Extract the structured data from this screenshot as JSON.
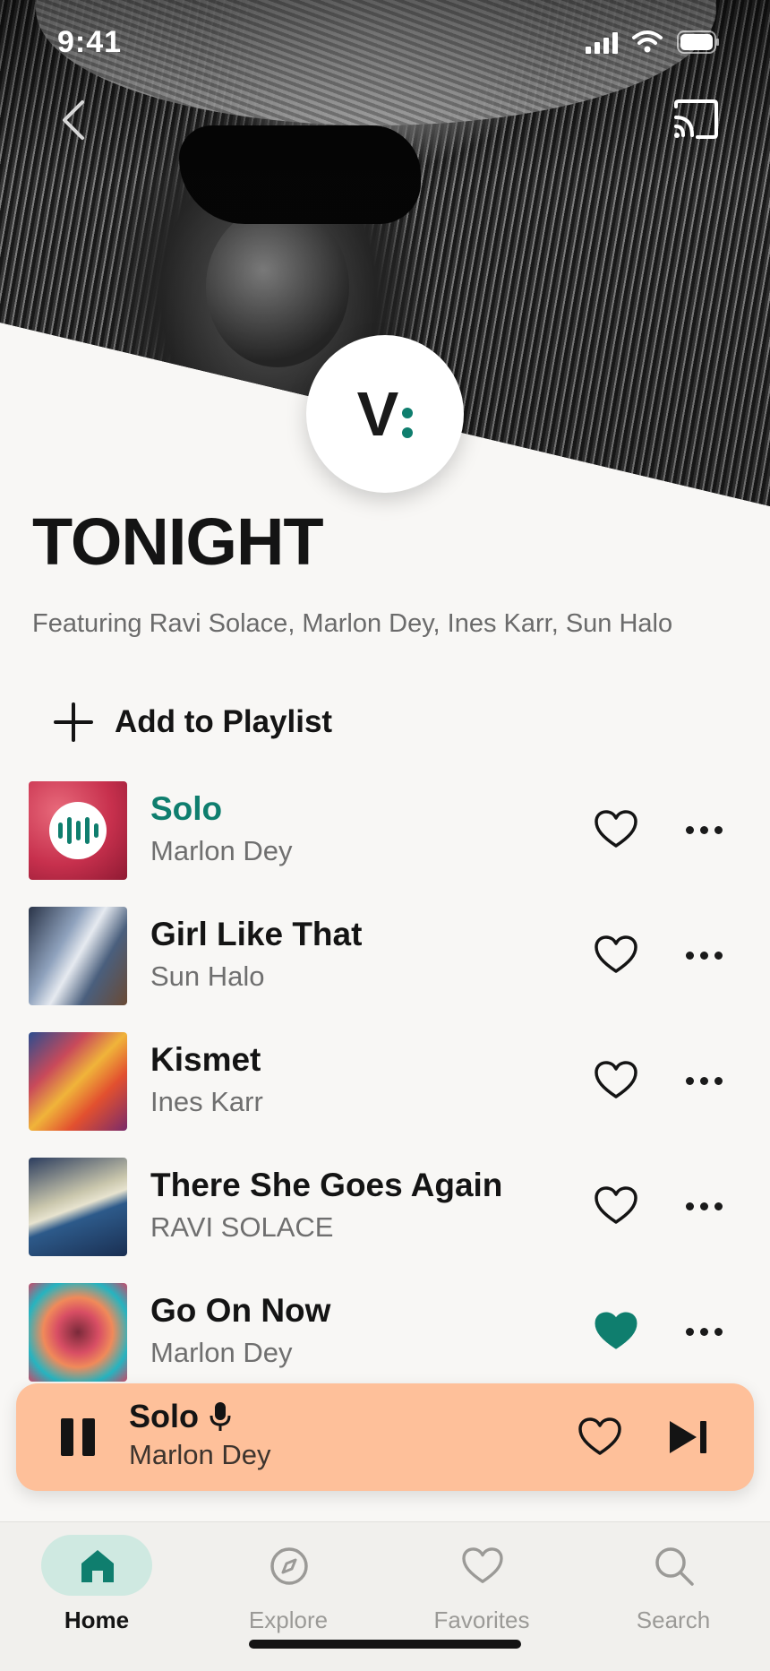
{
  "status_bar": {
    "time": "9:41"
  },
  "header": {
    "back_icon": "chevron-left-icon",
    "cast_icon": "cast-icon",
    "logo_letter": "V"
  },
  "playlist": {
    "title": "TONIGHT",
    "subtitle": "Featuring Ravi Solace, Marlon Dey, Ines Karr, Sun Halo",
    "add_label": "Add to Playlist"
  },
  "tracks": [
    {
      "title": "Solo",
      "artist": "Marlon Dey",
      "playing": true,
      "liked": false
    },
    {
      "title": "Girl Like That",
      "artist": "Sun Halo",
      "playing": false,
      "liked": false
    },
    {
      "title": "Kismet",
      "artist": "Ines Karr",
      "playing": false,
      "liked": false
    },
    {
      "title": "There She Goes Again",
      "artist": "RAVI SOLACE",
      "playing": false,
      "liked": false
    },
    {
      "title": "Go On Now",
      "artist": "Marlon Dey",
      "playing": false,
      "liked": true
    }
  ],
  "mini_player": {
    "title": "Solo",
    "artist": "Marlon Dey",
    "state": "playing"
  },
  "tab_bar": {
    "tabs": [
      {
        "label": "Home",
        "icon": "home-icon",
        "active": true
      },
      {
        "label": "Explore",
        "icon": "compass-icon",
        "active": false
      },
      {
        "label": "Favorites",
        "icon": "heart-icon",
        "active": false
      },
      {
        "label": "Search",
        "icon": "search-icon",
        "active": false
      }
    ]
  },
  "colors": {
    "accent": "#0f7e6e",
    "mini_player_bg": "#fec09a",
    "background": "#f8f7f5",
    "active_tab_pill": "#cfe9e1"
  }
}
